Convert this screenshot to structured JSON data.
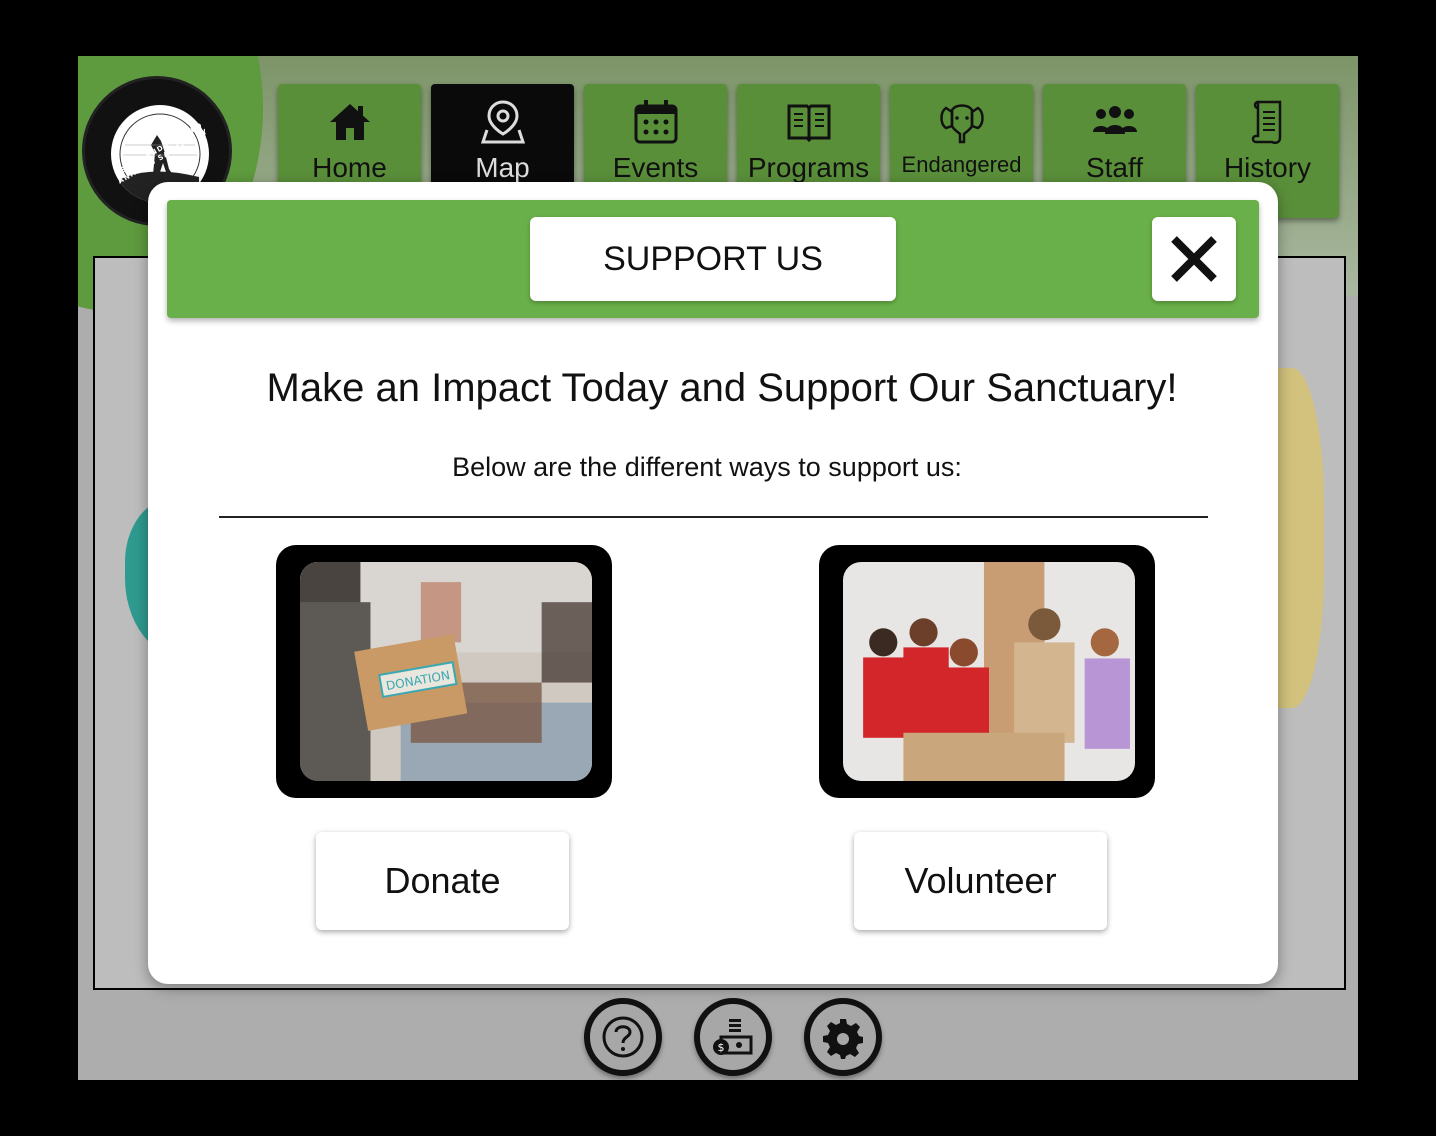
{
  "logo": {
    "text": "ASTON ENDANGERED ANIMALS SANCTUARY"
  },
  "nav": {
    "tabs": [
      {
        "label": "Home",
        "icon": "home-icon"
      },
      {
        "label": "Map",
        "icon": "map-pin-icon",
        "active": true
      },
      {
        "label": "Events",
        "icon": "calendar-icon"
      },
      {
        "label": "Programs",
        "icon": "book-icon"
      },
      {
        "label": "Endangered",
        "icon": "elephant-icon"
      },
      {
        "label": "Staff",
        "icon": "people-icon"
      },
      {
        "label": "History",
        "icon": "scroll-icon"
      }
    ]
  },
  "modal": {
    "title": "SUPPORT US",
    "headline": "Make an Impact Today and Support Our Sanctuary!",
    "subhead": "Below are the different ways to support us:",
    "donate_image_text": "DONATION",
    "donate_label": "Donate",
    "volunteer_label": "Volunteer"
  },
  "bottom_bar": {
    "icons": [
      "help-icon",
      "money-icon",
      "settings-icon"
    ]
  },
  "colors": {
    "header_green": "#6ab04a",
    "nav_green": "#5a8f3a",
    "active_tab": "#0a0a0a"
  }
}
